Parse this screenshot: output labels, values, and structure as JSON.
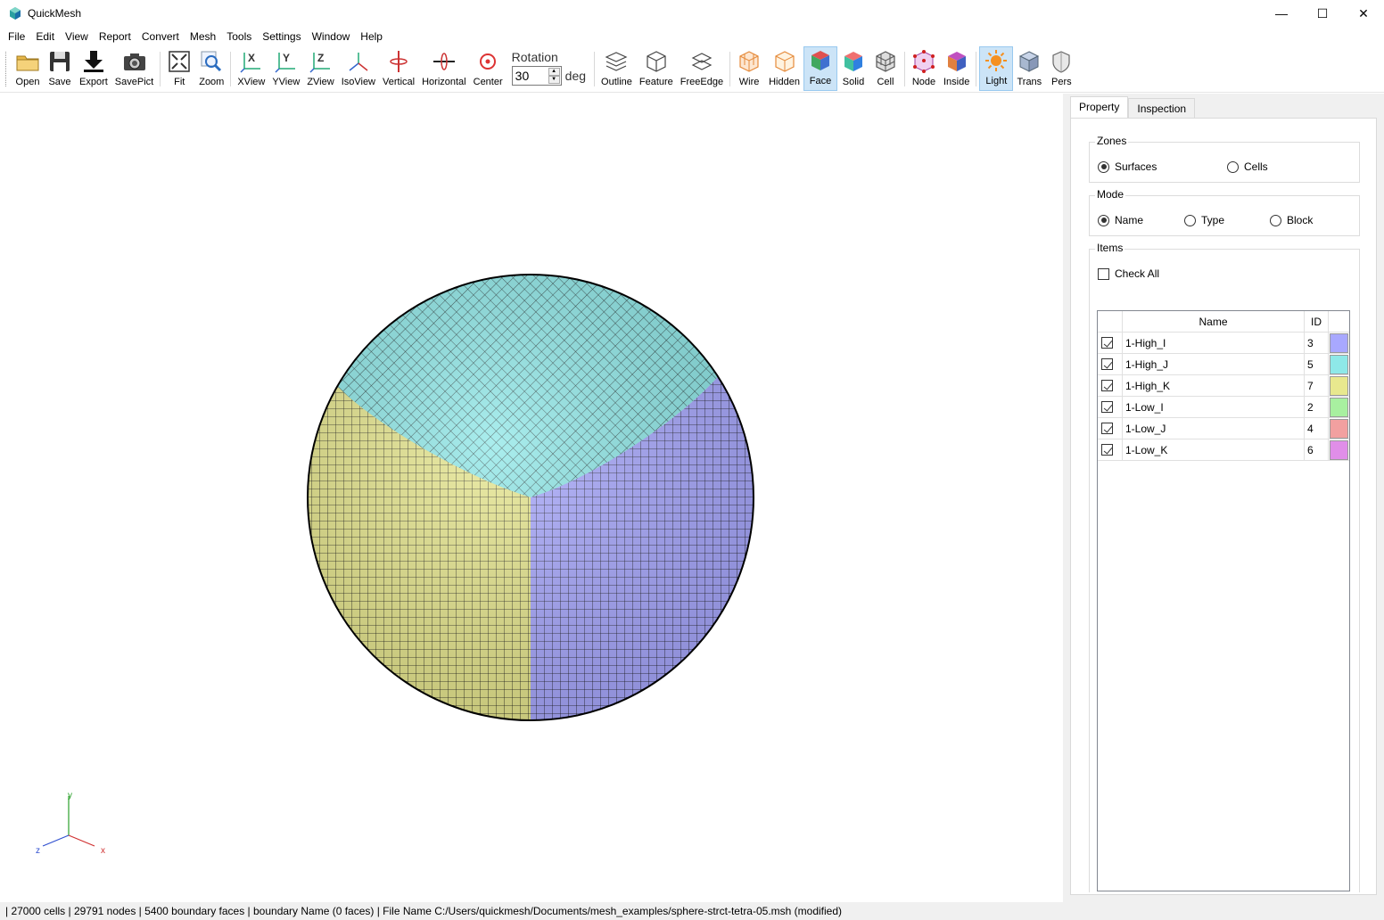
{
  "window": {
    "title": "QuickMesh",
    "minimize": "—",
    "maximize": "☐",
    "close": "✕"
  },
  "menu": [
    "File",
    "Edit",
    "View",
    "Report",
    "Convert",
    "Mesh",
    "Tools",
    "Settings",
    "Window",
    "Help"
  ],
  "toolbar": {
    "open": "Open",
    "save": "Save",
    "export": "Export",
    "savepict": "SavePict",
    "fit": "Fit",
    "zoom": "Zoom",
    "xview": "XView",
    "yview": "YView",
    "zview": "ZView",
    "isoview": "IsoView",
    "vertical": "Vertical",
    "horizontal": "Horizontal",
    "center": "Center",
    "rotation_label": "Rotation",
    "rotation_value": "30",
    "rotation_unit": "deg",
    "outline": "Outline",
    "feature": "Feature",
    "freeedge": "FreeEdge",
    "wire": "Wire",
    "hidden": "Hidden",
    "face": "Face",
    "solid": "Solid",
    "cell": "Cell",
    "node": "Node",
    "inside": "Inside",
    "light": "Light",
    "trans": "Trans",
    "pers": "Pers"
  },
  "axes": {
    "x": "x",
    "y": "y",
    "z": "z"
  },
  "panel": {
    "tabs": [
      "Property",
      "Inspection"
    ],
    "zones": {
      "title": "Zones",
      "options": [
        "Surfaces",
        "Cells"
      ],
      "selected": "Surfaces"
    },
    "mode": {
      "title": "Mode",
      "options": [
        "Name",
        "Type",
        "Block"
      ],
      "selected": "Name"
    },
    "items": {
      "title": "Items",
      "check_all": "Check All",
      "columns": {
        "name": "Name",
        "id": "ID"
      },
      "rows": [
        {
          "name": "1-High_I",
          "id": "3",
          "color": "#a8a8ff",
          "checked": true
        },
        {
          "name": "1-High_J",
          "id": "5",
          "color": "#8ee8e8",
          "checked": true
        },
        {
          "name": "1-High_K",
          "id": "7",
          "color": "#e8e88e",
          "checked": true
        },
        {
          "name": "1-Low_I",
          "id": "2",
          "color": "#a8f0a0",
          "checked": true
        },
        {
          "name": "1-Low_J",
          "id": "4",
          "color": "#f2a0a0",
          "checked": true
        },
        {
          "name": "1-Low_K",
          "id": "6",
          "color": "#e08ee8",
          "checked": true
        }
      ]
    }
  },
  "status": "| 27000 cells | 29791 nodes | 5400 boundary faces |  boundary Name  (0 faces) | File Name C:/Users/quickmesh/Documents/mesh_examples/sphere-strct-tetra-05.msh (modified)"
}
